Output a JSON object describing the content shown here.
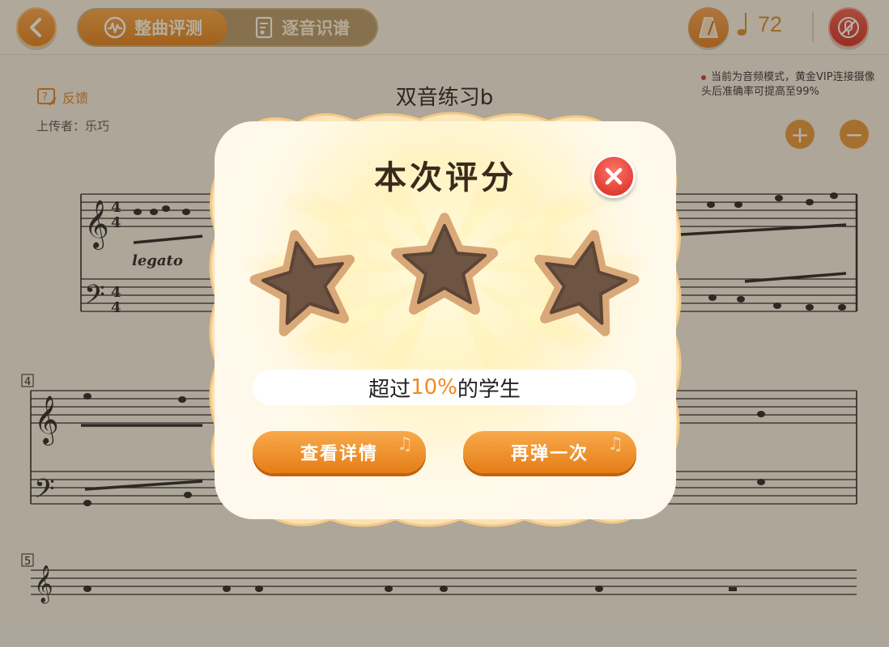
{
  "header": {
    "tabs": [
      {
        "label": "整曲评测"
      },
      {
        "label": "逐音识谱"
      }
    ],
    "tempo": "72"
  },
  "sheet": {
    "title": "双音练习b",
    "feedback_label": "反馈",
    "uploader": "上传者：乐巧",
    "notice": "当前为音频模式，黄金VIP连接摄像头后准确率可提高至99%",
    "zoom_in": "+",
    "zoom_out": "−",
    "measure_numbers": [
      "4",
      "5"
    ],
    "expression": "legato",
    "time_signature": "4/4"
  },
  "modal": {
    "title": "本次评分",
    "stars_earned": 0,
    "stars_total": 3,
    "percent_prefix": "超过",
    "percent_value": "10%",
    "percent_suffix": "的学生",
    "detail_button": "查看详情",
    "retry_button": "再弹一次"
  },
  "colors": {
    "accent_orange": "#e8871f",
    "close_red": "#d5271d",
    "star_brown": "#6e5443"
  },
  "icons": [
    "back-icon",
    "waveform-icon",
    "score-icon",
    "metronome-icon",
    "quarter-note-icon",
    "mic-off-icon",
    "feedback-icon",
    "close-icon",
    "star-icon"
  ]
}
